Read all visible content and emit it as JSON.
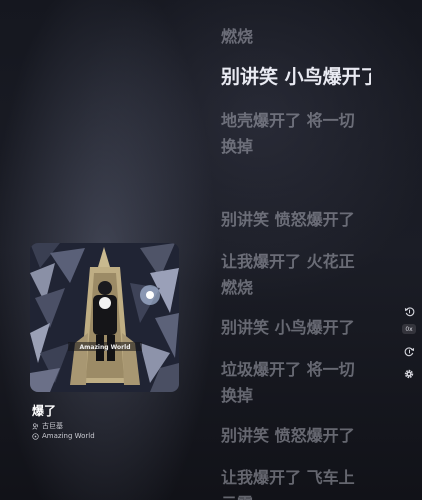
{
  "lyrics": [
    "燃烧",
    "别讲笑 小鸟爆开了",
    "地壳爆开了 将一切换掉",
    "别讲笑 愤怒爆开了",
    "让我爆开了 火花正燃烧",
    "别讲笑 小鸟爆开了",
    "垃圾爆开了 将一切换掉",
    "别讲笑 愤怒爆开了",
    "让我爆开了 飞车上云霄"
  ],
  "active_lyric_index": 1,
  "album_art_text": "Amazing World",
  "song": {
    "title": "爆了",
    "artist": "古巨基",
    "album": "Amazing World"
  },
  "controls": {
    "rewind_icon": "rewind-icon",
    "speed_label": "0x",
    "forward_icon": "forward-icon",
    "settings_icon": "settings-icon"
  },
  "colors": {
    "active_lyric": "#e9eaf2",
    "inactive_lyric": "#aaacb6"
  }
}
